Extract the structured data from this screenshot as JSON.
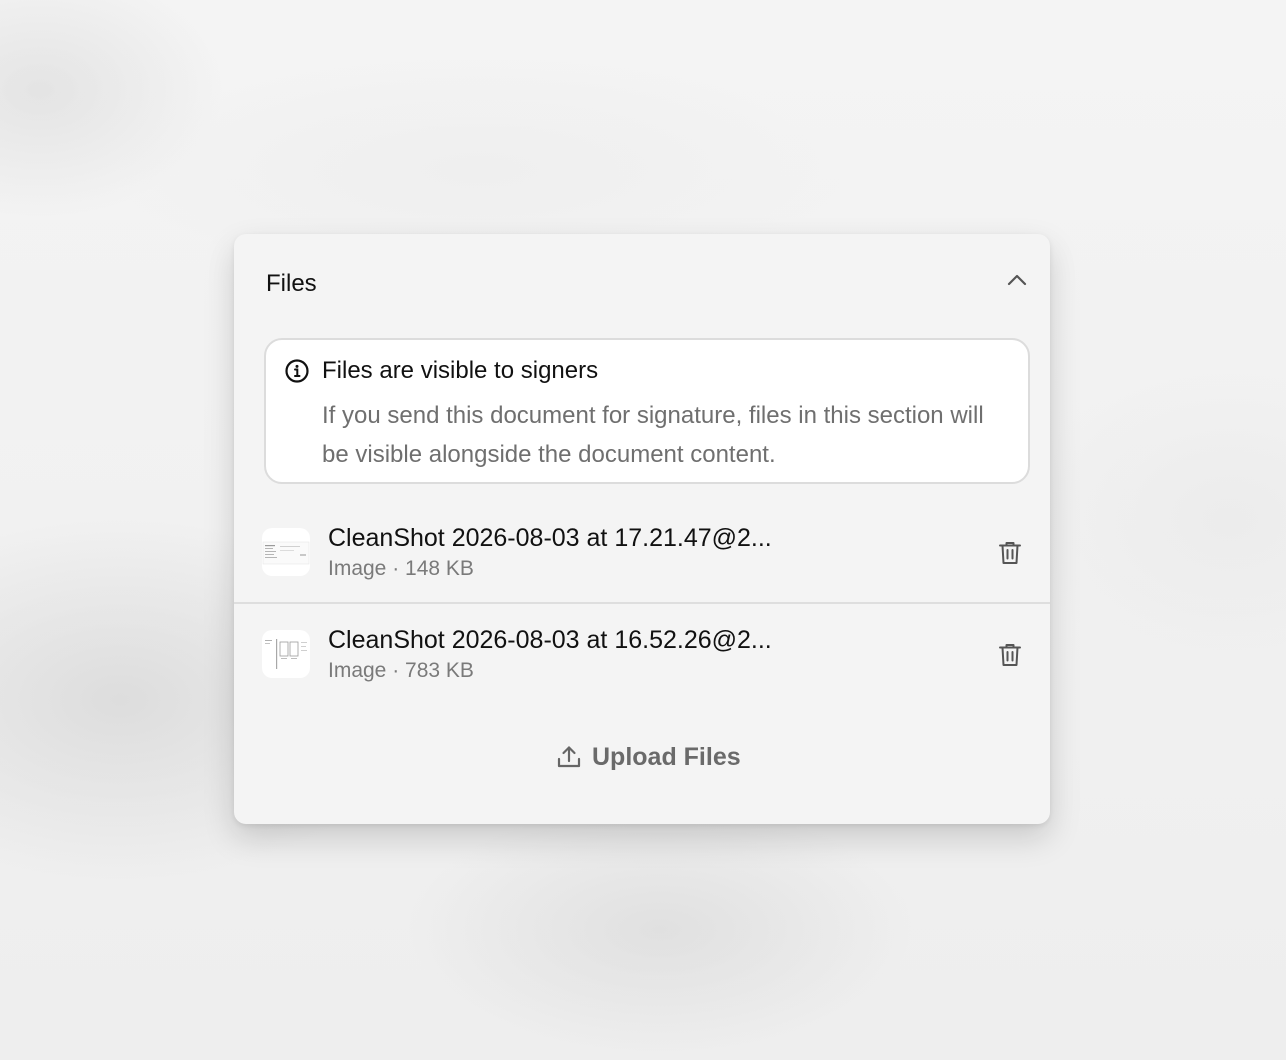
{
  "panel": {
    "title": "Files",
    "collapse_icon": "chevron-up-icon"
  },
  "notice": {
    "icon": "info-icon",
    "title": "Files are visible to signers",
    "body": "If you send this document for signature, files in this section will be visible alongside the document content."
  },
  "files": [
    {
      "name": "CleanShot 2026-08-03 at 17.21.47@2...",
      "meta": "Image · 148 KB",
      "thumbnail": "screenshot-thumbnail",
      "delete_icon": "trash-icon"
    },
    {
      "name": "CleanShot 2026-08-03 at 16.52.26@2...",
      "meta": "Image · 783 KB",
      "thumbnail": "screenshot-thumbnail",
      "delete_icon": "trash-icon"
    }
  ],
  "upload": {
    "label": "Upload Files",
    "icon": "upload-icon"
  },
  "colors": {
    "background": "#f2f2f2",
    "panel": "#f4f4f4",
    "text_primary": "#111111",
    "text_secondary": "#6f6f6f",
    "border": "#dcdcdc"
  }
}
